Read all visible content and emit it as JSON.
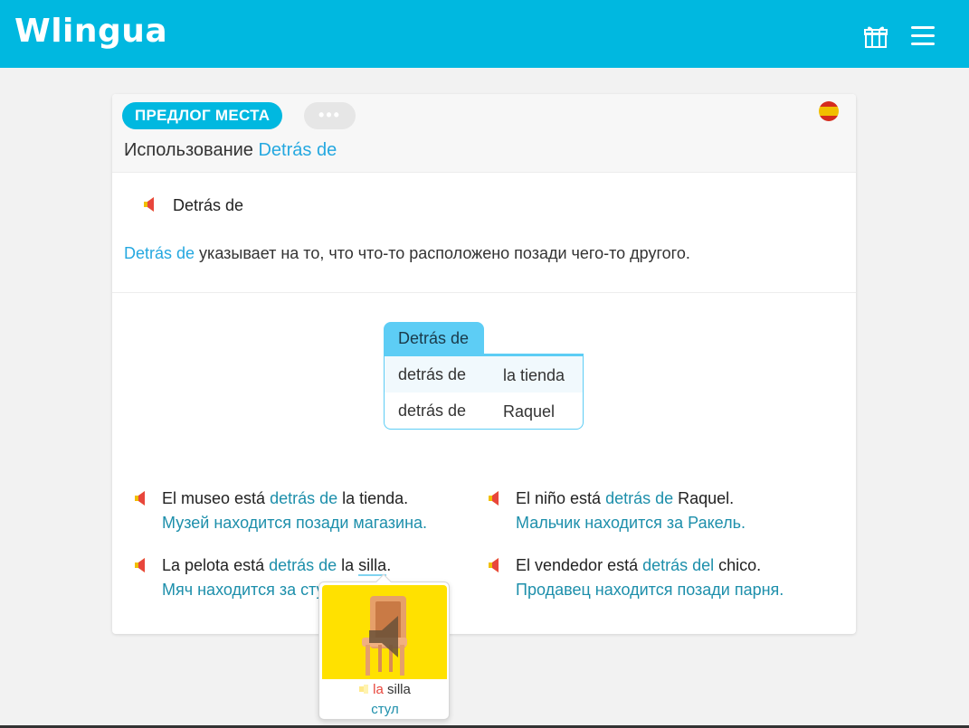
{
  "app": {
    "logo": "Wlingua",
    "icons": [
      "gift-icon",
      "menu-icon"
    ]
  },
  "lesson": {
    "topic": "ПРЕДЛОГ МЕСТА",
    "more_label": "•••",
    "flag": "spain-flag-icon",
    "title_prefix": "Использование",
    "title_term": "Detrás de",
    "term": "Detrás de",
    "definition_term": "Detrás de",
    "definition_text": " указывает на то, что что-то расположено позади чего-то другого."
  },
  "table": {
    "header": "Detrás de",
    "rows": [
      {
        "c1": "detrás de",
        "c2": "la tienda"
      },
      {
        "c1": "detrás de",
        "c2": "Raquel"
      }
    ]
  },
  "examples": [
    {
      "es_before": "El museo está ",
      "es_hl": "detrás de",
      "es_after": " la tienda.",
      "ru": "Музей находится позади магазина."
    },
    {
      "es_before": "El niño está ",
      "es_hl": "detrás de",
      "es_after": " Raquel.",
      "ru": "Мальчик находится за Ракель."
    },
    {
      "es_before": "La pelota está ",
      "es_hl": "detrás de",
      "es_mid": " la ",
      "es_word": "silla",
      "es_after": ".",
      "ru": "Мяч находится за стулом."
    },
    {
      "es_before": "El vendedor está ",
      "es_hl": "detrás del",
      "es_after": " chico.",
      "ru": "Продавец находится позади парня."
    }
  ],
  "popover": {
    "article": "la",
    "word": " silla",
    "translation": "стул",
    "image": "chair-icon"
  },
  "colors": {
    "brand": "#00b8e0",
    "highlight": "#25a8e0",
    "translation": "#1d8fab",
    "popover_image_bg": "#ffe100"
  }
}
